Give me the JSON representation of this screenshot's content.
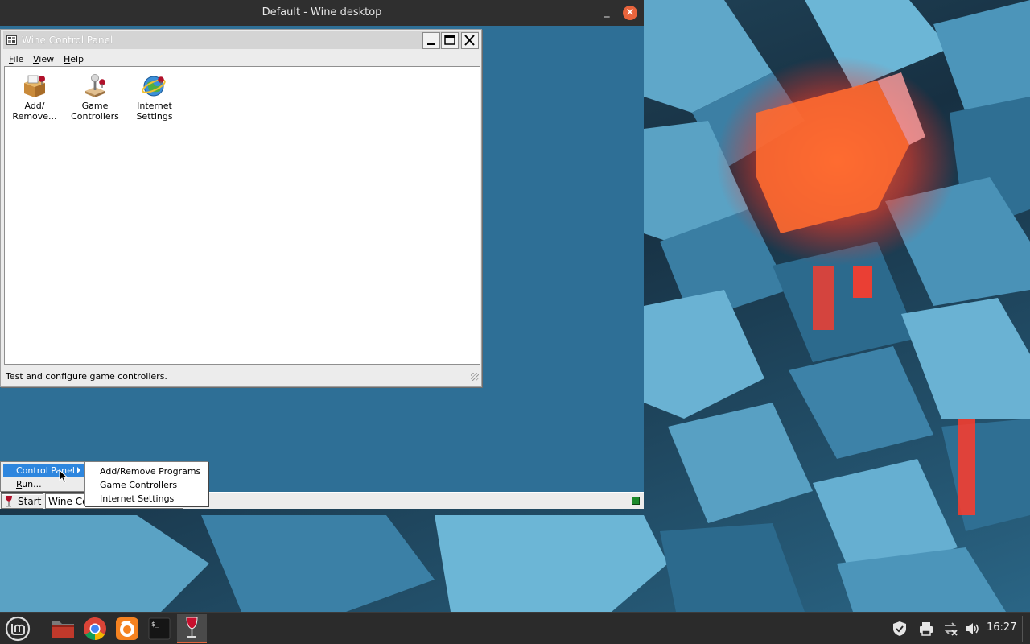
{
  "host": {
    "window_title": "Default - Wine desktop",
    "clock": "16:27"
  },
  "control_panel": {
    "title": "Wine Control Panel",
    "menu": {
      "file": "File",
      "view": "View",
      "help": "Help"
    },
    "applets": [
      {
        "label": "Add/ Remove...",
        "icon": "add-remove-programs-icon"
      },
      {
        "label": "Game Controllers",
        "icon": "joystick-icon"
      },
      {
        "label": "Internet Settings",
        "icon": "internet-globe-icon"
      }
    ],
    "status_text": "Test and configure game controllers."
  },
  "wine_taskbar": {
    "start_label": "Start",
    "task_label": "Wine Control Panel"
  },
  "start_menu": {
    "items": [
      {
        "label": "Control Panel",
        "has_submenu": true,
        "highlighted": true
      },
      {
        "label": "Run..."
      }
    ],
    "submenu": [
      {
        "label": "Add/Remove Programs"
      },
      {
        "label": "Game Controllers"
      },
      {
        "label": "Internet Settings"
      }
    ]
  },
  "colors": {
    "accent_orange": "#e8643c",
    "menu_highlight": "#2e86de",
    "wine_desktop": "#2e6f96"
  }
}
